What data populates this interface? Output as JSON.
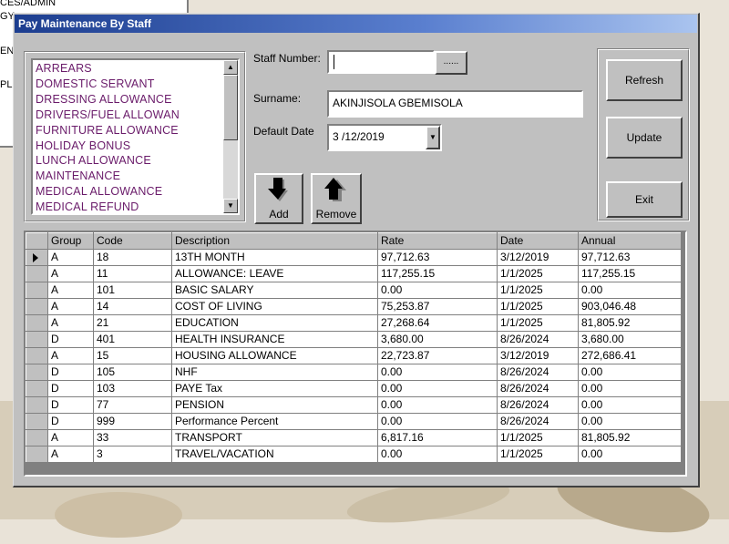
{
  "background_window": {
    "lines": [
      "CES/ADMIN",
      "GY",
      "EN",
      "PL"
    ]
  },
  "window": {
    "title": "Pay Maintenance By Staff"
  },
  "allowance_list": {
    "items": [
      "ARREARS",
      "DOMESTIC SERVANT",
      "DRESSING ALLOWANCE",
      "DRIVERS/FUEL ALLOWAN",
      "FURNITURE ALLOWANCE",
      "HOLIDAY BONUS",
      "LUNCH ALLOWANCE",
      "MAINTENANCE",
      "MEDICAL ALLOWANCE",
      "MEDICAL REFUND"
    ]
  },
  "form": {
    "staff_number_label": "Staff Number:",
    "staff_number_value": "",
    "lookup_button_label": "......",
    "surname_label": "Surname:",
    "surname_value": "AKINJISOLA GBEMISOLA",
    "default_date_label": "Default Date",
    "default_date_value": "3 /12/2019"
  },
  "actions": {
    "add_label": "Add",
    "remove_label": "Remove",
    "refresh_label": "Refresh",
    "update_label": "Update",
    "exit_label": "Exit"
  },
  "table": {
    "columns": [
      "Group",
      "Code",
      "Description",
      "Rate",
      "Date",
      "Annual"
    ],
    "rows": [
      [
        "A",
        "18",
        "13TH MONTH",
        "97,712.63",
        "3/12/2019",
        "97,712.63"
      ],
      [
        "A",
        "11",
        "ALLOWANCE: LEAVE",
        "117,255.15",
        "1/1/2025",
        "117,255.15"
      ],
      [
        "A",
        "101",
        "BASIC SALARY",
        "0.00",
        "1/1/2025",
        "0.00"
      ],
      [
        "A",
        "14",
        "COST OF LIVING",
        "75,253.87",
        "1/1/2025",
        "903,046.48"
      ],
      [
        "A",
        "21",
        "EDUCATION",
        "27,268.64",
        "1/1/2025",
        "81,805.92"
      ],
      [
        "D",
        "401",
        "HEALTH INSURANCE",
        "3,680.00",
        "8/26/2024",
        "3,680.00"
      ],
      [
        "A",
        "15",
        "HOUSING ALLOWANCE",
        "22,723.87",
        "3/12/2019",
        "272,686.41"
      ],
      [
        "D",
        "105",
        "NHF",
        "0.00",
        "8/26/2024",
        "0.00"
      ],
      [
        "D",
        "103",
        "PAYE Tax",
        "0.00",
        "8/26/2024",
        "0.00"
      ],
      [
        "D",
        "77",
        "PENSION",
        "0.00",
        "8/26/2024",
        "0.00"
      ],
      [
        "D",
        "999",
        "Performance Percent",
        "0.00",
        "8/26/2024",
        "0.00"
      ],
      [
        "A",
        "33",
        "TRANSPORT",
        "6,817.16",
        "1/1/2025",
        "81,805.92"
      ],
      [
        "A",
        "3",
        "TRAVEL/VACATION",
        "0.00",
        "1/1/2025",
        "0.00"
      ]
    ]
  }
}
